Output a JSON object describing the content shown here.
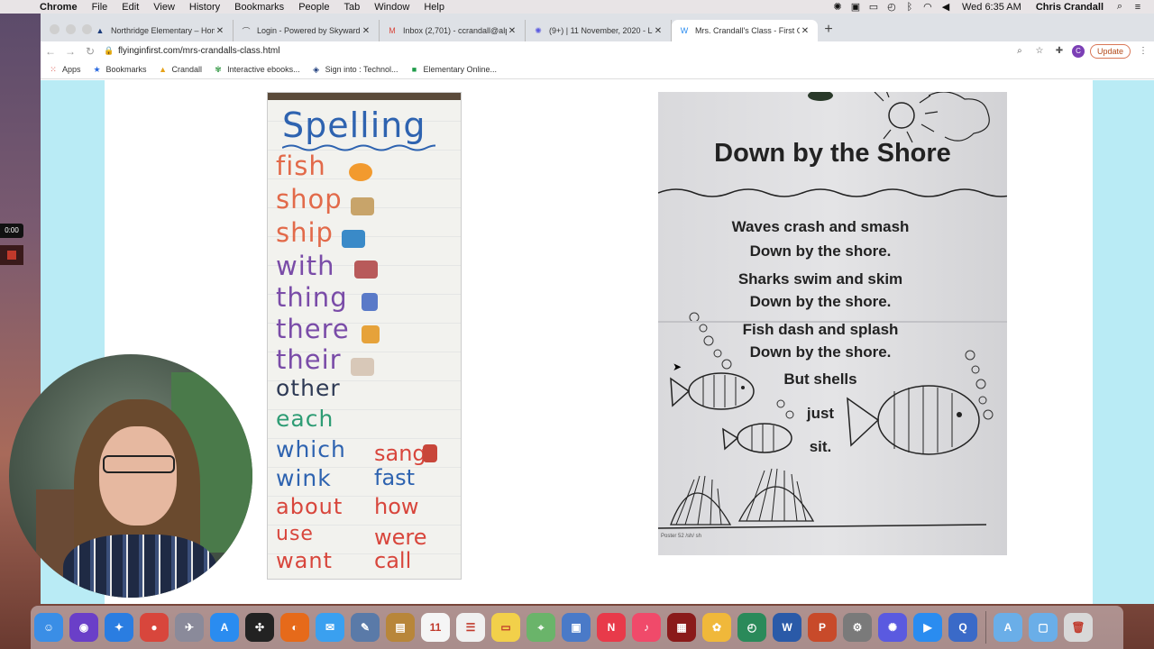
{
  "menubar": {
    "app": "Chrome",
    "items": [
      "File",
      "Edit",
      "View",
      "History",
      "Bookmarks",
      "People",
      "Tab",
      "Window",
      "Help"
    ],
    "clock": "Wed 6:35 AM",
    "user": "Chris Crandall"
  },
  "tabs": [
    {
      "title": "Northridge Elementary – Home",
      "favicon": "mountain-icon"
    },
    {
      "title": "Login - Powered by Skyward",
      "favicon": "skyward-icon"
    },
    {
      "title": "Inbox (2,701) - ccrandall@alpin",
      "favicon": "gmail-icon"
    },
    {
      "title": "(9+) | 11 November, 2020 - Lo",
      "favicon": "flower-icon"
    },
    {
      "title": "Mrs. Crandall's Class - First G",
      "favicon": "weebly-icon"
    }
  ],
  "address": {
    "url": "flyinginfirst.com/mrs-crandalls-class.html"
  },
  "toolbar": {
    "profile_initial": "C",
    "update_label": "Update"
  },
  "bookmarks": [
    {
      "label": "Apps",
      "icon": "apps-grid-icon"
    },
    {
      "label": "Bookmarks",
      "icon": "star-icon"
    },
    {
      "label": "Crandall",
      "icon": "drive-icon"
    },
    {
      "label": "Interactive ebooks...",
      "icon": "sprout-icon"
    },
    {
      "label": "Sign into : Technol...",
      "icon": "owl-icon"
    },
    {
      "label": "Elementary Online...",
      "icon": "classroom-icon"
    }
  ],
  "spelling_chart": {
    "title": "Spelling",
    "words": [
      {
        "text": "fish",
        "color": "#e26a4a"
      },
      {
        "text": "shop",
        "color": "#e26a4a"
      },
      {
        "text": "ship",
        "color": "#e26a4a"
      },
      {
        "text": "with",
        "color": "#7a4ca8"
      },
      {
        "text": "thing",
        "color": "#7a4ca8"
      },
      {
        "text": "there",
        "color": "#7a4ca8"
      },
      {
        "text": "their",
        "color": "#7a4ca8"
      },
      {
        "text": "other",
        "color": "#2e3a55"
      },
      {
        "text": "each",
        "color": "#2e9c74"
      },
      {
        "text": "which",
        "color": "#2e63b0"
      },
      {
        "text": "wink",
        "color": "#2e63b0"
      },
      {
        "text": "about",
        "color": "#d8463c"
      },
      {
        "text": "use",
        "color": "#d8463c"
      },
      {
        "text": "want",
        "color": "#d8463c"
      }
    ],
    "right_words": [
      {
        "text": "sang",
        "color": "#d8463c"
      },
      {
        "text": "fast",
        "color": "#2e63b0"
      },
      {
        "text": "how",
        "color": "#d8463c"
      },
      {
        "text": "were",
        "color": "#d8463c"
      },
      {
        "text": "call",
        "color": "#d8463c"
      }
    ]
  },
  "poem": {
    "title": "Down by the Shore",
    "lines": [
      "Waves crash and smash",
      "Down by the shore.",
      "Sharks swim and skim",
      "Down by the shore.",
      "Fish dash and splash",
      "Down by the shore.",
      "But shells",
      "just",
      "sit."
    ],
    "footer": "Poster 52 /sh/ sh"
  },
  "recording": {
    "time": "0:00"
  },
  "dock": [
    {
      "name": "finder-icon",
      "label": "☺",
      "color": "#3a8ee6"
    },
    {
      "name": "siri-icon",
      "label": "◉",
      "color": "#6a3fc8"
    },
    {
      "name": "safari-icon",
      "label": "✦",
      "color": "#2a7de1"
    },
    {
      "name": "chrome-icon",
      "label": "●",
      "color": "#d8463c"
    },
    {
      "name": "launchpad-icon",
      "label": "✈",
      "color": "#8a8a9a"
    },
    {
      "name": "app-store-icon",
      "label": "A",
      "color": "#2a8cf0"
    },
    {
      "name": "compass-icon",
      "label": "✣",
      "color": "#222222"
    },
    {
      "name": "firefox-icon",
      "label": "◐",
      "color": "#e66a1a"
    },
    {
      "name": "messages-icon",
      "label": "✉",
      "color": "#3aa0f0"
    },
    {
      "name": "preview-icon",
      "label": "✎",
      "color": "#5a7aa8"
    },
    {
      "name": "notebook-icon",
      "label": "▤",
      "color": "#b8863a"
    },
    {
      "name": "calendar-icon",
      "label": "11",
      "color": "#f5f5f5"
    },
    {
      "name": "reminders-icon",
      "label": "☰",
      "color": "#f0f0f0"
    },
    {
      "name": "notes-icon",
      "label": "▭",
      "color": "#f2d04a"
    },
    {
      "name": "maps-icon",
      "label": "⌖",
      "color": "#6ab46a"
    },
    {
      "name": "photo-browser-icon",
      "label": "▣",
      "color": "#4a7ac8"
    },
    {
      "name": "news-icon",
      "label": "N",
      "color": "#e83a4a"
    },
    {
      "name": "music-icon",
      "label": "♪",
      "color": "#f04a6a"
    },
    {
      "name": "photo-booth-icon",
      "label": "▦",
      "color": "#8a1a1a"
    },
    {
      "name": "photos-icon",
      "label": "✿",
      "color": "#f0b83a"
    },
    {
      "name": "time-machine-icon",
      "label": "◴",
      "color": "#2a8a5a"
    },
    {
      "name": "word-icon",
      "label": "W",
      "color": "#2a5aa8"
    },
    {
      "name": "powerpoint-icon",
      "label": "P",
      "color": "#c84a2a"
    },
    {
      "name": "system-preferences-icon",
      "label": "⚙",
      "color": "#7a7a7a"
    },
    {
      "name": "screencastify-icon",
      "label": "✺",
      "color": "#5a5ae0"
    },
    {
      "name": "zoom-icon",
      "label": "▶",
      "color": "#2a8cf0"
    },
    {
      "name": "quicktime-icon",
      "label": "Q",
      "color": "#3a6ac8"
    },
    {
      "name": "applications-folder-icon",
      "label": "A",
      "color": "#6aaee8"
    },
    {
      "name": "documents-folder-icon",
      "label": "▢",
      "color": "#6aaee8"
    },
    {
      "name": "trash-icon",
      "label": "🗑",
      "color": "#d8d8d8"
    }
  ]
}
